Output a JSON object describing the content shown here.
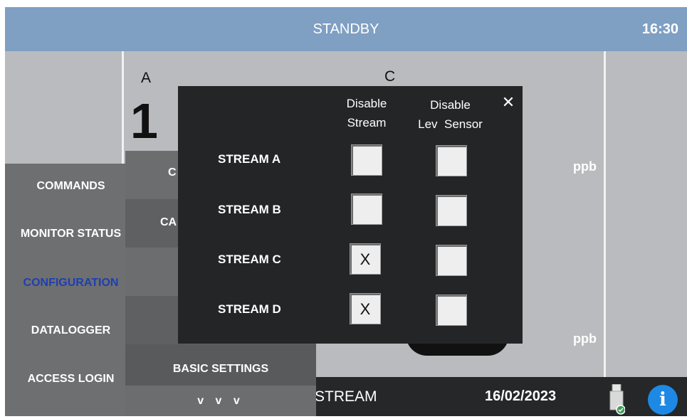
{
  "header": {
    "title": "STANDBY",
    "time": "16:30"
  },
  "main": {
    "stream_labels": [
      "A",
      "C"
    ],
    "big_value": "1",
    "units": [
      "ppb",
      "ppb"
    ],
    "partial_letters": [
      "C",
      "CA"
    ]
  },
  "side_menu": {
    "items": [
      {
        "label": "COMMANDS",
        "active": false
      },
      {
        "label": "MONITOR STATUS",
        "active": false
      },
      {
        "label": "CONFIGURATION",
        "active": true
      },
      {
        "label": "DATALOGGER",
        "active": false
      },
      {
        "label": "ACCESS LOGIN",
        "active": false
      }
    ],
    "active_color": "#1f3fb0"
  },
  "sub_menu": {
    "basic_settings": "BASIC SETTINGS",
    "more": "v  v  v"
  },
  "modal": {
    "col1_header": [
      "Disable",
      "Stream"
    ],
    "col2_header": [
      "Disable",
      "Lev  Sensor"
    ],
    "close_label": "✕",
    "rows": [
      {
        "label": "STREAM A",
        "disable_stream": "",
        "disable_lev_sensor": ""
      },
      {
        "label": "STREAM B",
        "disable_stream": "",
        "disable_lev_sensor": ""
      },
      {
        "label": "STREAM C",
        "disable_stream": "X",
        "disable_lev_sensor": ""
      },
      {
        "label": "STREAM D",
        "disable_stream": "X",
        "disable_lev_sensor": ""
      }
    ]
  },
  "status_bar": {
    "stream": "STREAM",
    "date": "16/02/2023",
    "info": "i"
  },
  "colors": {
    "header": "#7f9fc3",
    "modal": "#242526",
    "info": "#1e88e5"
  }
}
